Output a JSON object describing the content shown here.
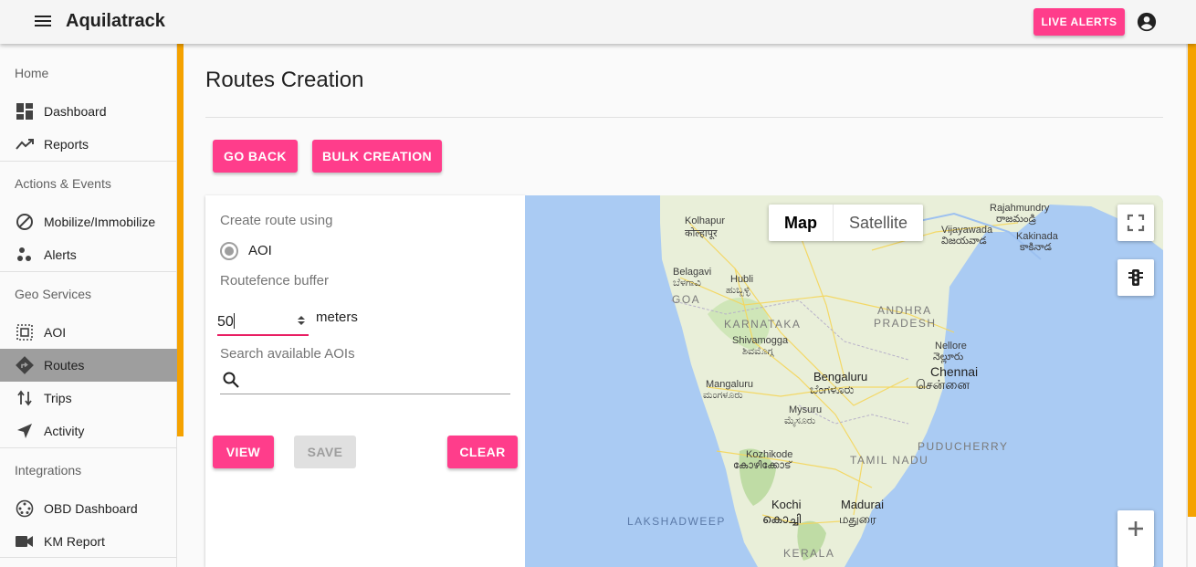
{
  "app": {
    "title": "Aquilatrack",
    "live_alerts_label": "LIVE ALERTS"
  },
  "sidebar": {
    "sections": [
      {
        "title": "Home",
        "items": [
          {
            "label": "Dashboard",
            "icon": "dashboard-icon"
          },
          {
            "label": "Reports",
            "icon": "trending-icon"
          }
        ]
      },
      {
        "title": "Actions & Events",
        "items": [
          {
            "label": "Mobilize/Immobilize",
            "icon": "block-icon"
          },
          {
            "label": "Alerts",
            "icon": "scatter-icon"
          }
        ]
      },
      {
        "title": "Geo Services",
        "items": [
          {
            "label": "AOI",
            "icon": "select-all-icon"
          },
          {
            "label": "Routes",
            "icon": "directions-icon",
            "active": true
          },
          {
            "label": "Trips",
            "icon": "swap-vert-icon"
          },
          {
            "label": "Activity",
            "icon": "navigation-icon"
          }
        ]
      },
      {
        "title": "Integrations",
        "items": [
          {
            "label": "OBD Dashboard",
            "icon": "obd-icon"
          },
          {
            "label": "KM Report",
            "icon": "videocam-icon"
          }
        ]
      }
    ]
  },
  "main": {
    "title": "Routes Creation",
    "go_back_label": "GO BACK",
    "bulk_creation_label": "BULK CREATION"
  },
  "form": {
    "create_using_label": "Create route using",
    "radio_option": "AOI",
    "buffer_label": "Routefence buffer",
    "buffer_value": "50",
    "buffer_unit": "meters",
    "search_label": "Search available AOIs",
    "view_label": "VIEW",
    "save_label": "SAVE",
    "clear_label": "CLEAR"
  },
  "map": {
    "map_type_map": "Map",
    "map_type_satellite": "Satellite",
    "labels": {
      "kolhapur": "Kolhapur",
      "kolhapur_local": "कोल्हापूर",
      "belagavi": "Belagavi",
      "belagavi_local": "ಬೆಳಗಾವಿ",
      "hubli": "Hubli",
      "hubli_local": "ಹುಬ್ಬಳ್ಳಿ",
      "goa": "GOA",
      "karnataka": "KARNATAKA",
      "shivamogga": "Shivamogga",
      "shivamogga_local": "ಶಿವಮೊಗ್ಗ",
      "mangaluru": "Mangaluru",
      "mangaluru_local": "ಮಂಗಳೂರು",
      "bengaluru": "Bengaluru",
      "bengaluru_local": "ಬೆಂಗಳೂರು",
      "mysuru": "Mysuru",
      "mysuru_local": "ಮೈಸೂರು",
      "andhra": "ANDHRA",
      "pradesh": "PRADESH",
      "nellore": "Nellore",
      "nellore_local": "నెల్లూరు",
      "chennai": "Chennai",
      "chennai_local": "சென்னை",
      "rajahmundry": "Rajahmundry",
      "rajahmundry_local": "రాజమండ్రి",
      "vijayawada": "Vijayawada",
      "vijayawada_local": "విజయవాడ",
      "kakinada": "Kakinada",
      "kakinada_local": "కాకినాడ",
      "puducherry": "PUDUCHERRY",
      "tamil_nadu": "TAMIL NADU",
      "kozhikode": "Kozhikode",
      "kozhikode_local": "കോഴിക്കോട്",
      "kochi": "Kochi",
      "kochi_local": "കൊച്ചി",
      "madurai": "Madurai",
      "madurai_local": "மதுரை",
      "lakshadweep": "LAKSHADWEEP",
      "kerala": "KERALA"
    }
  }
}
